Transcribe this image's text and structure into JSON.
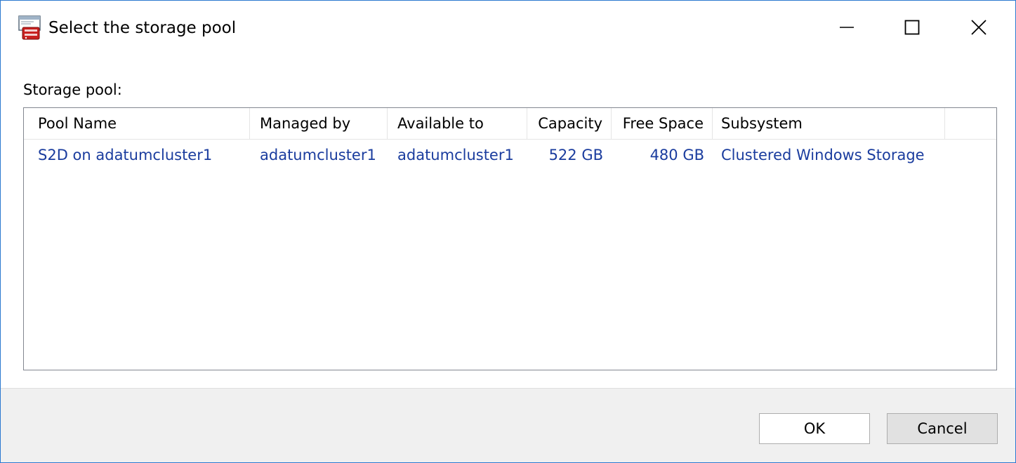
{
  "window": {
    "title": "Select the storage pool",
    "icon": "storage-pool-icon",
    "controls": {
      "minimize": "minimize-icon",
      "maximize": "maximize-icon",
      "close": "close-icon"
    }
  },
  "content": {
    "label": "Storage pool:",
    "columns": [
      "Pool Name",
      "Managed by",
      "Available to",
      "Capacity",
      "Free Space",
      "Subsystem"
    ],
    "rows": [
      {
        "pool_name": "S2D on adatumcluster1",
        "managed_by": "adatumcluster1",
        "available_to": "adatumcluster1",
        "capacity": "522 GB",
        "free_space": "480 GB",
        "subsystem": "Clustered Windows Storage"
      }
    ]
  },
  "buttons": {
    "ok": "OK",
    "cancel": "Cancel"
  },
  "colors": {
    "accent": "#2b79d0",
    "link_text": "#1a3c9e",
    "footer_bg": "#f0f0f0"
  }
}
